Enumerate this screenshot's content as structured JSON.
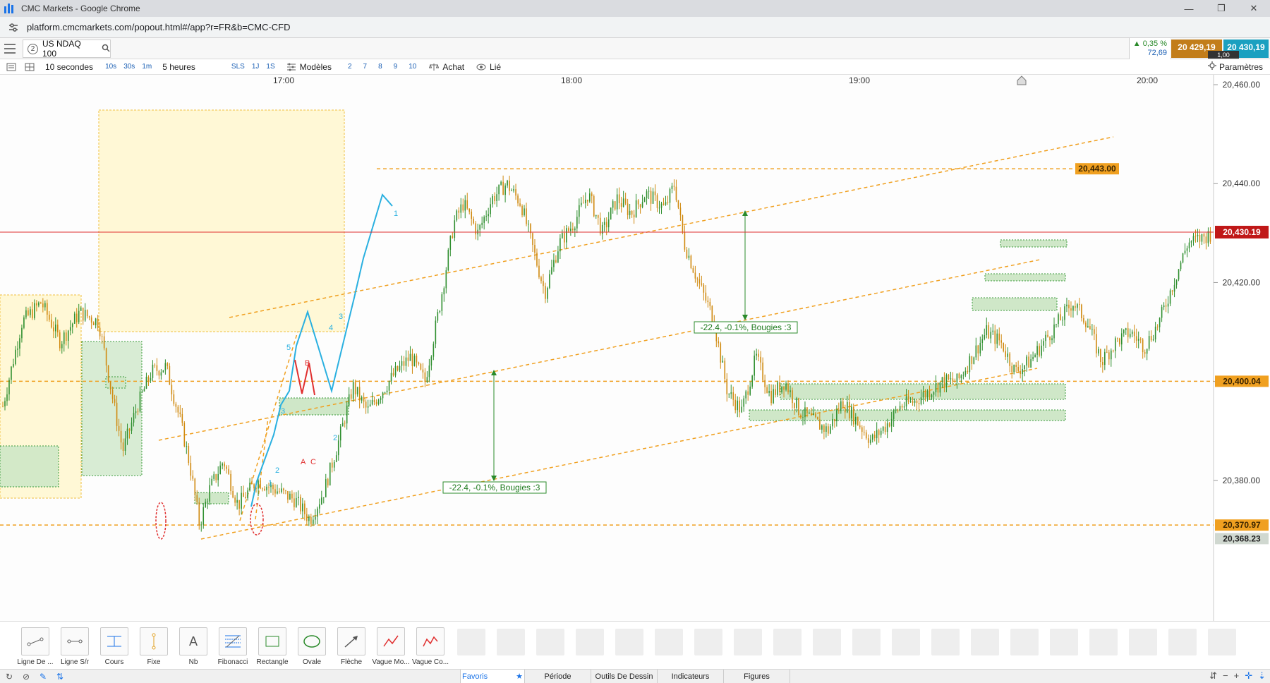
{
  "window": {
    "title": "CMC Markets - Google Chrome",
    "controls": [
      "—",
      "❐",
      "✕"
    ]
  },
  "browser": {
    "url": "platform.cmcmarkets.com/popout.html#/app?r=FR&b=CMC-CFD"
  },
  "instrument": {
    "tab_number": "2",
    "name": "US NDAQ 100",
    "change_percent": "▲ 0,35 %",
    "change_points": "72,69",
    "bid": "20 429,19",
    "ask": "20 430,19",
    "spread": "1,00"
  },
  "toolbar": {
    "interval": "10 secondes",
    "interval_chips": [
      "10s",
      "30s",
      "1m"
    ],
    "period": "5 heures",
    "period_chips": [
      "SLS",
      "1J",
      "1S"
    ],
    "templates_label": "Modèles",
    "template_chips": [
      "2",
      "7",
      "8",
      "9",
      "10"
    ],
    "buy_label": "Achat",
    "link_label": "Lié",
    "settings_label": "Paramètres"
  },
  "chart_data": {
    "type": "candlestick",
    "instrument": "US NDAQ 100",
    "x_ticks": [
      "17:00",
      "18:00",
      "19:00",
      "20:00"
    ],
    "y_ticks": [
      "20,460.00",
      "20,440.00",
      "20,420.00",
      "20,400.00",
      "20,380.00"
    ],
    "ylim": [
      20365,
      20462
    ],
    "current_price_label": "20,430.19",
    "current_price": 20430.19,
    "level_labels": [
      {
        "label": "20,443.00",
        "value": 20443.0,
        "color": "#f0a020"
      },
      {
        "label": "20,400.04",
        "value": 20400.04,
        "color": "#f0a020"
      },
      {
        "label": "20,370.97",
        "value": 20370.97,
        "color": "#f0a020"
      },
      {
        "label": "20,368.23",
        "value": 20368.23,
        "color": "#d0d8d0"
      }
    ],
    "annotations": [
      "-22.4, -0.1%, Bougies :3",
      "-22.4, -0.1%, Bougies :3"
    ],
    "wave_labels": [
      "1",
      "2",
      "3",
      "4",
      "5",
      "1",
      "2",
      "3",
      "A",
      "B",
      "C"
    ],
    "price_path": [
      [
        0,
        20395
      ],
      [
        20,
        20412
      ],
      [
        40,
        20416
      ],
      [
        60,
        20408
      ],
      [
        80,
        20414
      ],
      [
        100,
        20412
      ],
      [
        115,
        20396
      ],
      [
        125,
        20386
      ],
      [
        140,
        20395
      ],
      [
        155,
        20402
      ],
      [
        170,
        20403
      ],
      [
        185,
        20392
      ],
      [
        195,
        20383
      ],
      [
        205,
        20371
      ],
      [
        215,
        20378
      ],
      [
        230,
        20384
      ],
      [
        245,
        20375
      ],
      [
        265,
        20380
      ],
      [
        285,
        20378
      ],
      [
        305,
        20376
      ],
      [
        320,
        20372
      ],
      [
        335,
        20378
      ],
      [
        350,
        20388
      ],
      [
        365,
        20399
      ],
      [
        380,
        20394
      ],
      [
        395,
        20398
      ],
      [
        410,
        20402
      ],
      [
        425,
        20405
      ],
      [
        440,
        20400
      ],
      [
        455,
        20415
      ],
      [
        470,
        20432
      ],
      [
        480,
        20436
      ],
      [
        495,
        20430
      ],
      [
        510,
        20437
      ],
      [
        525,
        20440
      ],
      [
        540,
        20436
      ],
      [
        555,
        20425
      ],
      [
        565,
        20418
      ],
      [
        580,
        20428
      ],
      [
        595,
        20432
      ],
      [
        610,
        20438
      ],
      [
        625,
        20430
      ],
      [
        640,
        20437
      ],
      [
        655,
        20434
      ],
      [
        670,
        20438
      ],
      [
        690,
        20435
      ],
      [
        700,
        20440
      ],
      [
        710,
        20428
      ],
      [
        725,
        20420
      ],
      [
        740,
        20413
      ],
      [
        755,
        20398
      ],
      [
        770,
        20394
      ],
      [
        785,
        20405
      ],
      [
        800,
        20397
      ],
      [
        815,
        20400
      ],
      [
        830,
        20394
      ],
      [
        845,
        20392
      ],
      [
        860,
        20390
      ],
      [
        875,
        20396
      ],
      [
        890,
        20392
      ],
      [
        905,
        20388
      ],
      [
        920,
        20391
      ],
      [
        935,
        20395
      ],
      [
        950,
        20396
      ],
      [
        965,
        20398
      ],
      [
        980,
        20400
      ],
      [
        995,
        20400
      ],
      [
        1010,
        20405
      ],
      [
        1025,
        20410
      ],
      [
        1040,
        20408
      ],
      [
        1055,
        20402
      ],
      [
        1070,
        20404
      ],
      [
        1085,
        20408
      ],
      [
        1100,
        20412
      ],
      [
        1115,
        20416
      ],
      [
        1130,
        20412
      ],
      [
        1145,
        20404
      ],
      [
        1160,
        20408
      ],
      [
        1175,
        20410
      ],
      [
        1190,
        20407
      ],
      [
        1205,
        20412
      ],
      [
        1220,
        20420
      ],
      [
        1235,
        20428
      ],
      [
        1250,
        20429
      ],
      [
        1260,
        20430
      ]
    ],
    "grid": true
  },
  "tools": {
    "items": [
      {
        "label": "Ligne De ...",
        "icon": "trend-line-icon"
      },
      {
        "label": "Ligne S/r",
        "icon": "horizontal-line-icon"
      },
      {
        "label": "Cours",
        "icon": "price-line-icon"
      },
      {
        "label": "Fixe",
        "icon": "fixed-line-icon"
      },
      {
        "label": "Nb",
        "icon": "text-icon"
      },
      {
        "label": "Fibonacci",
        "icon": "fibonacci-icon"
      },
      {
        "label": "Rectangle",
        "icon": "rectangle-icon"
      },
      {
        "label": "Ovale",
        "icon": "oval-icon"
      },
      {
        "label": "Flèche",
        "icon": "arrow-icon"
      },
      {
        "label": "Vague Mo...",
        "icon": "wave-icon"
      },
      {
        "label": "Vague Co...",
        "icon": "corrective-wave-icon"
      }
    ],
    "text_glyph": "A"
  },
  "bottom_tabs": {
    "favorites": "Favoris",
    "period": "Période",
    "drawing_tools": "Outils De Dessin",
    "indicators": "Indicateurs",
    "figures": "Figures"
  },
  "icons": {
    "refresh": "↻",
    "no": "⊘",
    "pencil": "✎",
    "magnet": "⇅",
    "star": "★",
    "bottom_right": [
      "⇵",
      "−",
      "+",
      "✛",
      "⇣"
    ]
  }
}
